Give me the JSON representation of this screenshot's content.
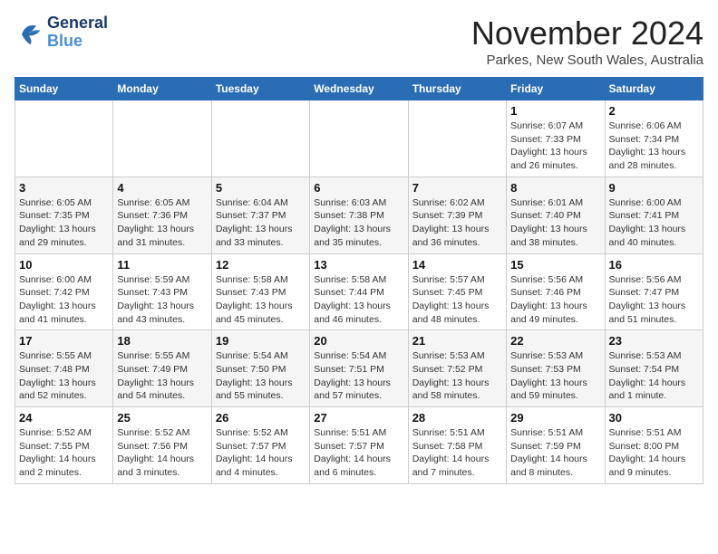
{
  "logo": {
    "line1": "General",
    "line2": "Blue"
  },
  "title": "November 2024",
  "location": "Parkes, New South Wales, Australia",
  "days_of_week": [
    "Sunday",
    "Monday",
    "Tuesday",
    "Wednesday",
    "Thursday",
    "Friday",
    "Saturday"
  ],
  "weeks": [
    [
      {
        "day": "",
        "info": ""
      },
      {
        "day": "",
        "info": ""
      },
      {
        "day": "",
        "info": ""
      },
      {
        "day": "",
        "info": ""
      },
      {
        "day": "",
        "info": ""
      },
      {
        "day": "1",
        "info": "Sunrise: 6:07 AM\nSunset: 7:33 PM\nDaylight: 13 hours\nand 26 minutes."
      },
      {
        "day": "2",
        "info": "Sunrise: 6:06 AM\nSunset: 7:34 PM\nDaylight: 13 hours\nand 28 minutes."
      }
    ],
    [
      {
        "day": "3",
        "info": "Sunrise: 6:05 AM\nSunset: 7:35 PM\nDaylight: 13 hours\nand 29 minutes."
      },
      {
        "day": "4",
        "info": "Sunrise: 6:05 AM\nSunset: 7:36 PM\nDaylight: 13 hours\nand 31 minutes."
      },
      {
        "day": "5",
        "info": "Sunrise: 6:04 AM\nSunset: 7:37 PM\nDaylight: 13 hours\nand 33 minutes."
      },
      {
        "day": "6",
        "info": "Sunrise: 6:03 AM\nSunset: 7:38 PM\nDaylight: 13 hours\nand 35 minutes."
      },
      {
        "day": "7",
        "info": "Sunrise: 6:02 AM\nSunset: 7:39 PM\nDaylight: 13 hours\nand 36 minutes."
      },
      {
        "day": "8",
        "info": "Sunrise: 6:01 AM\nSunset: 7:40 PM\nDaylight: 13 hours\nand 38 minutes."
      },
      {
        "day": "9",
        "info": "Sunrise: 6:00 AM\nSunset: 7:41 PM\nDaylight: 13 hours\nand 40 minutes."
      }
    ],
    [
      {
        "day": "10",
        "info": "Sunrise: 6:00 AM\nSunset: 7:42 PM\nDaylight: 13 hours\nand 41 minutes."
      },
      {
        "day": "11",
        "info": "Sunrise: 5:59 AM\nSunset: 7:43 PM\nDaylight: 13 hours\nand 43 minutes."
      },
      {
        "day": "12",
        "info": "Sunrise: 5:58 AM\nSunset: 7:43 PM\nDaylight: 13 hours\nand 45 minutes."
      },
      {
        "day": "13",
        "info": "Sunrise: 5:58 AM\nSunset: 7:44 PM\nDaylight: 13 hours\nand 46 minutes."
      },
      {
        "day": "14",
        "info": "Sunrise: 5:57 AM\nSunset: 7:45 PM\nDaylight: 13 hours\nand 48 minutes."
      },
      {
        "day": "15",
        "info": "Sunrise: 5:56 AM\nSunset: 7:46 PM\nDaylight: 13 hours\nand 49 minutes."
      },
      {
        "day": "16",
        "info": "Sunrise: 5:56 AM\nSunset: 7:47 PM\nDaylight: 13 hours\nand 51 minutes."
      }
    ],
    [
      {
        "day": "17",
        "info": "Sunrise: 5:55 AM\nSunset: 7:48 PM\nDaylight: 13 hours\nand 52 minutes."
      },
      {
        "day": "18",
        "info": "Sunrise: 5:55 AM\nSunset: 7:49 PM\nDaylight: 13 hours\nand 54 minutes."
      },
      {
        "day": "19",
        "info": "Sunrise: 5:54 AM\nSunset: 7:50 PM\nDaylight: 13 hours\nand 55 minutes."
      },
      {
        "day": "20",
        "info": "Sunrise: 5:54 AM\nSunset: 7:51 PM\nDaylight: 13 hours\nand 57 minutes."
      },
      {
        "day": "21",
        "info": "Sunrise: 5:53 AM\nSunset: 7:52 PM\nDaylight: 13 hours\nand 58 minutes."
      },
      {
        "day": "22",
        "info": "Sunrise: 5:53 AM\nSunset: 7:53 PM\nDaylight: 13 hours\nand 59 minutes."
      },
      {
        "day": "23",
        "info": "Sunrise: 5:53 AM\nSunset: 7:54 PM\nDaylight: 14 hours\nand 1 minute."
      }
    ],
    [
      {
        "day": "24",
        "info": "Sunrise: 5:52 AM\nSunset: 7:55 PM\nDaylight: 14 hours\nand 2 minutes."
      },
      {
        "day": "25",
        "info": "Sunrise: 5:52 AM\nSunset: 7:56 PM\nDaylight: 14 hours\nand 3 minutes."
      },
      {
        "day": "26",
        "info": "Sunrise: 5:52 AM\nSunset: 7:57 PM\nDaylight: 14 hours\nand 4 minutes."
      },
      {
        "day": "27",
        "info": "Sunrise: 5:51 AM\nSunset: 7:57 PM\nDaylight: 14 hours\nand 6 minutes."
      },
      {
        "day": "28",
        "info": "Sunrise: 5:51 AM\nSunset: 7:58 PM\nDaylight: 14 hours\nand 7 minutes."
      },
      {
        "day": "29",
        "info": "Sunrise: 5:51 AM\nSunset: 7:59 PM\nDaylight: 14 hours\nand 8 minutes."
      },
      {
        "day": "30",
        "info": "Sunrise: 5:51 AM\nSunset: 8:00 PM\nDaylight: 14 hours\nand 9 minutes."
      }
    ]
  ]
}
